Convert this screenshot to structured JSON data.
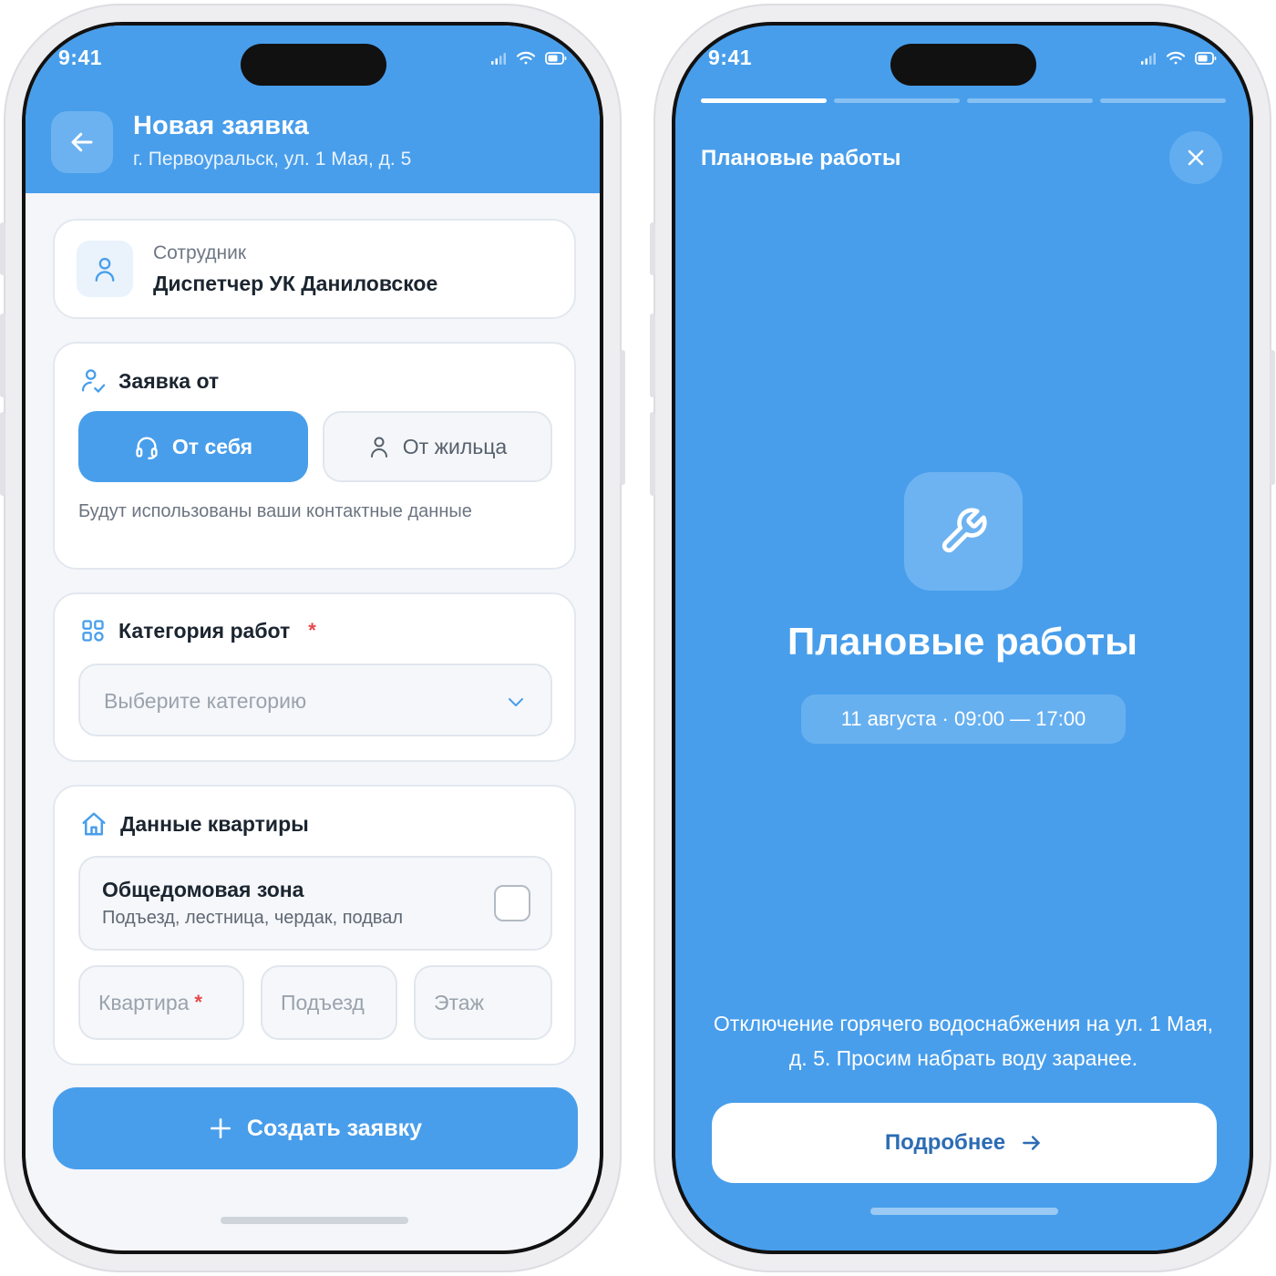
{
  "status_bar": {
    "time": "9:41"
  },
  "left_screen": {
    "header": {
      "title": "Новая заявка",
      "address": "г. Первоуральск, ул. 1 Мая, д. 5"
    },
    "employee": {
      "label": "Сотрудник",
      "name": "Диспетчер УК Даниловское"
    },
    "request_from": {
      "title": "Заявка от",
      "options": [
        {
          "label": "От себя",
          "icon": "headset-icon",
          "selected": true
        },
        {
          "label": "От жильца",
          "icon": "user-icon",
          "selected": false
        }
      ],
      "hint": "Будут использованы ваши контактные данные"
    },
    "category": {
      "title": "Категория работ",
      "required_mark": "*",
      "placeholder": "Выберите категорию"
    },
    "apartment": {
      "title": "Данные квартиры",
      "common_zone": {
        "title": "Общедомовая зона",
        "subtitle": "Подъезд, лестница, чердак, подвал",
        "checked": false
      },
      "fields": [
        {
          "placeholder": "Квартира",
          "required_mark": "*"
        },
        {
          "placeholder": "Подъезд"
        },
        {
          "placeholder": "Этаж"
        }
      ]
    },
    "submit_label": "Создать заявку"
  },
  "right_screen": {
    "progress": {
      "total": 4,
      "current": 1
    },
    "story_title": "Плановые работы",
    "hero_icon": "wrench-icon",
    "headline": "Плановые работы",
    "datetime": "11 августа · 09:00 — 17:00",
    "description": "Отключение горячего водоснабжения на ул. 1 Мая, д. 5. Просим набрать воду заранее.",
    "more_label": "Подробнее"
  },
  "colors": {
    "accent": "#489eeb",
    "background": "#f4f6fa",
    "required": "#e5484d",
    "text_dark": "#1b2530"
  }
}
